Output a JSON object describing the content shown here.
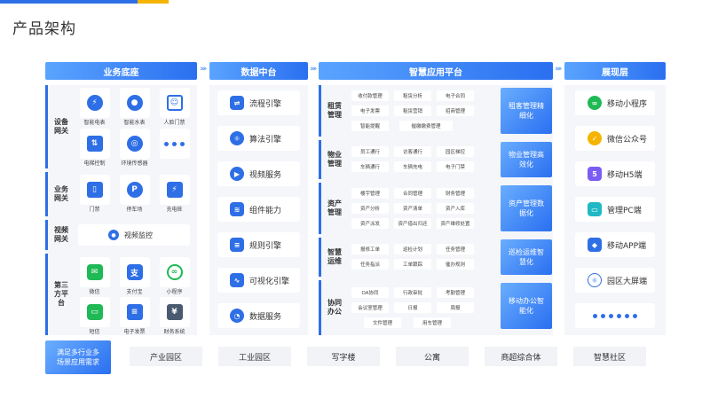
{
  "title": "产品架构",
  "headers": {
    "col1": "业务底座",
    "col2": "数据中台",
    "col3": "智慧应用平台",
    "col4": "展现层"
  },
  "arrows": "››››",
  "base": {
    "rows": [
      {
        "label": "设备\n网关",
        "items": [
          {
            "label": "智能电表",
            "icon": "lightning-icon"
          },
          {
            "label": "智能水表",
            "icon": "water-drop-icon"
          },
          {
            "label": "人脸门禁",
            "icon": "face-scan-icon"
          },
          {
            "label": "电梯控制",
            "icon": "elevator-icon"
          },
          {
            "label": "环境传感器",
            "icon": "sensor-icon"
          },
          {
            "label": "",
            "icon": "more-dots-icon"
          }
        ]
      },
      {
        "label": "业务\n网关",
        "items": [
          {
            "label": "门禁",
            "icon": "door-icon"
          },
          {
            "label": "停车场",
            "icon": "parking-icon"
          },
          {
            "label": "充电桩",
            "icon": "charger-icon"
          }
        ]
      },
      {
        "label": "视频\n网关",
        "items": [
          {
            "label": "视频监控",
            "icon": "camera-icon"
          }
        ]
      },
      {
        "label": "第三\n方平\n台",
        "items": [
          {
            "label": "微信",
            "icon": "wechat-icon"
          },
          {
            "label": "支付宝",
            "icon": "alipay-icon"
          },
          {
            "label": "小程序",
            "icon": "miniprogram-icon"
          },
          {
            "label": "短信",
            "icon": "sms-icon"
          },
          {
            "label": "电子发票",
            "icon": "invoice-icon"
          },
          {
            "label": "财务系统",
            "icon": "finance-icon"
          }
        ]
      }
    ]
  },
  "middle": [
    {
      "label": "流程引擎",
      "icon": "flow-icon"
    },
    {
      "label": "算法引擎",
      "icon": "atom-icon"
    },
    {
      "label": "视频服务",
      "icon": "play-icon"
    },
    {
      "label": "组件能力",
      "icon": "layers-icon"
    },
    {
      "label": "规则引擎",
      "icon": "document-icon"
    },
    {
      "label": "可视化引擎",
      "icon": "chart-icon"
    },
    {
      "label": "数据服务",
      "icon": "pie-icon"
    }
  ],
  "apps": [
    {
      "label": "租赁\n管理",
      "chips": [
        "收付款管理",
        "租赁分析",
        "电子合同",
        "电子发票",
        "租赁营销",
        "招商管理",
        "智能提醒",
        "催缴缴费管理"
      ],
      "summary": "租客管理精\n细化"
    },
    {
      "label": "物业\n管理",
      "chips": [
        "员工通行",
        "访客通行",
        "园区梯控",
        "车辆通行",
        "车辆充电",
        "电子门禁"
      ],
      "summary": "物业管理高\n效化"
    },
    {
      "label": "资产\n管理",
      "chips": [
        "楼宇管理",
        "合同管理",
        "财务管理",
        "资产分析",
        "资产清单",
        "资产入库",
        "资产派发",
        "资产借出归还",
        "资产维修处置"
      ],
      "summary": "资产管理数\n据化"
    },
    {
      "label": "智慧\n运维",
      "chips": [
        "报修工单",
        "巡检计划",
        "任务管理",
        "任务指派",
        "工单跟踪",
        "催办规则"
      ],
      "summary": "巡检运维智\n慧化"
    },
    {
      "label": "协同\n办公",
      "chips": [
        "OA协同",
        "行政审批",
        "考勤管理",
        "会议室管理",
        "日报",
        "周报",
        "文件管理",
        "用车管理"
      ],
      "summary": "移动办公智\n能化"
    }
  ],
  "display": [
    {
      "label": "移动小程序",
      "icon": "miniprogram-icon"
    },
    {
      "label": "微信公众号",
      "icon": "wechat-official-icon"
    },
    {
      "label": "移动H5端",
      "icon": "html5-icon"
    },
    {
      "label": "管理PC端",
      "icon": "monitor-icon"
    },
    {
      "label": "移动APP端",
      "icon": "cube-icon"
    },
    {
      "label": "园区大屏端",
      "icon": "react-icon"
    }
  ],
  "bottom": {
    "summary": "满足多行业多\n场景应用需求",
    "scenes": [
      "产业园区",
      "工业园区",
      "写字楼",
      "公寓",
      "商超综合体",
      "智慧社区"
    ]
  },
  "colors": {
    "accent": "#2e6fe6",
    "yellow": "#f5b400",
    "green": "#1fb955",
    "orange": "#f5a623",
    "red": "#f05a4a",
    "purple": "#7b5cf5"
  }
}
